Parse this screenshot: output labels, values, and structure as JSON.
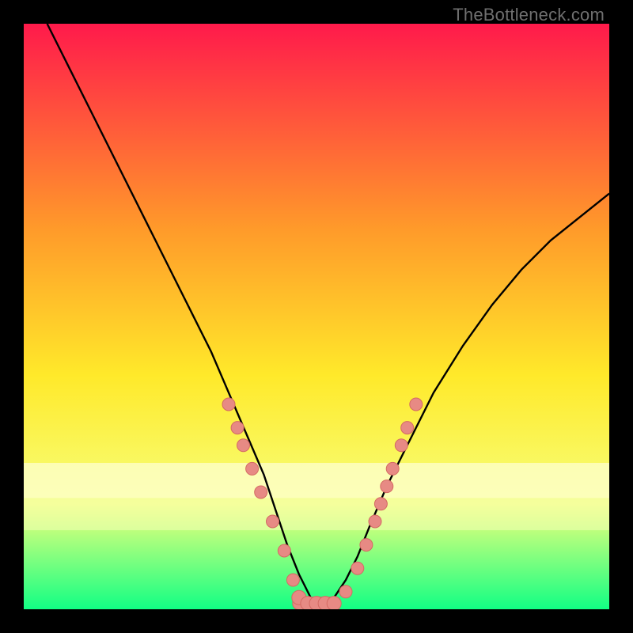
{
  "watermark": "TheBottleneck.com",
  "colors": {
    "gradient_top": "#ff1a4b",
    "gradient_upper_mid": "#ff9a2a",
    "gradient_mid": "#ffe92a",
    "gradient_lower_mid": "#f6ff7a",
    "gradient_bottom": "#12ff84",
    "curve": "#000000",
    "marker_fill": "#e78a84",
    "marker_stroke": "#d46a63",
    "band_light": "#feffd0",
    "band_lighter": "#f4ffb8"
  },
  "chart_data": {
    "type": "line",
    "title": "",
    "xlabel": "",
    "ylabel": "",
    "xlim": [
      0,
      100
    ],
    "ylim": [
      0,
      100
    ],
    "series": [
      {
        "name": "bottleneck-curve",
        "x": [
          4,
          8,
          12,
          16,
          20,
          24,
          28,
          32,
          35,
          38,
          41,
          43,
          45,
          47,
          49,
          50,
          51,
          53,
          55,
          57,
          59,
          62,
          66,
          70,
          75,
          80,
          85,
          90,
          95,
          100
        ],
        "y": [
          100,
          92,
          84,
          76,
          68,
          60,
          52,
          44,
          37,
          30,
          23,
          17,
          11,
          6,
          2,
          1,
          1,
          2,
          5,
          9,
          14,
          21,
          29,
          37,
          45,
          52,
          58,
          63,
          67,
          71
        ]
      }
    ],
    "markers": [
      {
        "x": 35.0,
        "y": 35.0
      },
      {
        "x": 36.5,
        "y": 31.0
      },
      {
        "x": 37.5,
        "y": 28.0
      },
      {
        "x": 39.0,
        "y": 24.0
      },
      {
        "x": 40.5,
        "y": 20.0
      },
      {
        "x": 42.5,
        "y": 15.0
      },
      {
        "x": 44.5,
        "y": 10.0
      },
      {
        "x": 46.0,
        "y": 5.0
      },
      {
        "x": 47.0,
        "y": 2.0
      },
      {
        "x": 48.5,
        "y": 1.0
      },
      {
        "x": 50.0,
        "y": 1.0
      },
      {
        "x": 51.5,
        "y": 1.0
      },
      {
        "x": 53.0,
        "y": 1.0
      },
      {
        "x": 55.0,
        "y": 3.0
      },
      {
        "x": 57.0,
        "y": 7.0
      },
      {
        "x": 58.5,
        "y": 11.0
      },
      {
        "x": 60.0,
        "y": 15.0
      },
      {
        "x": 61.0,
        "y": 18.0
      },
      {
        "x": 62.0,
        "y": 21.0
      },
      {
        "x": 63.0,
        "y": 24.0
      },
      {
        "x": 64.5,
        "y": 28.0
      },
      {
        "x": 65.5,
        "y": 31.0
      },
      {
        "x": 67.0,
        "y": 35.0
      }
    ],
    "annotations": []
  }
}
